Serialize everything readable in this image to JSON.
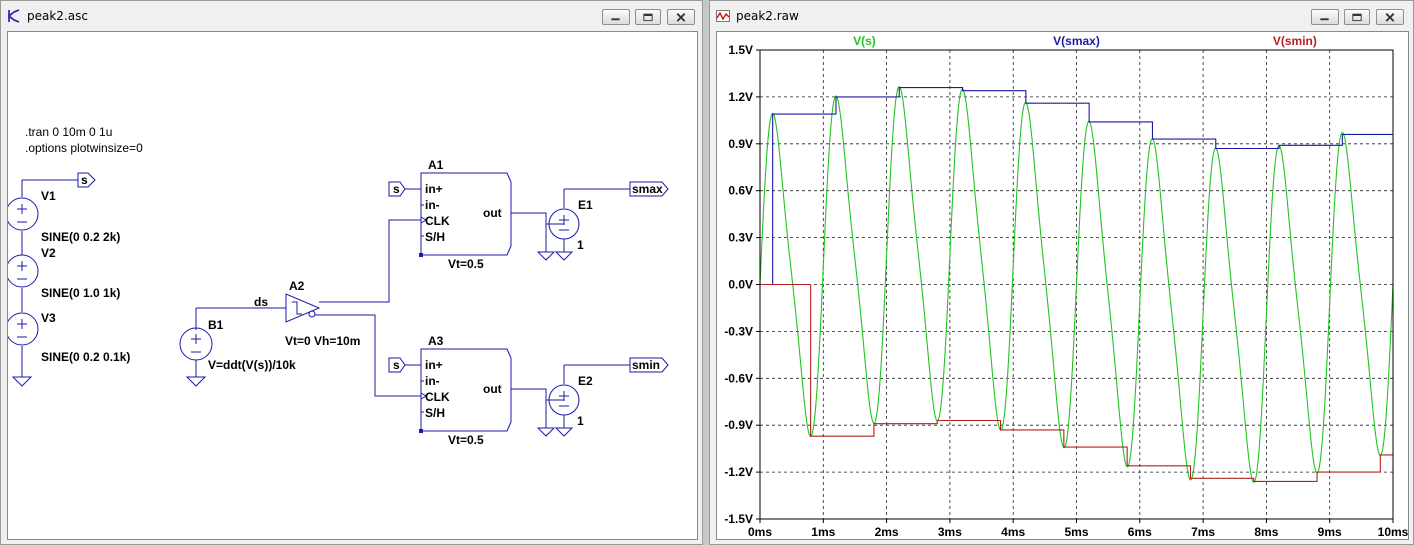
{
  "left_window": {
    "title": "peak2.asc",
    "directives": [
      ".tran 0 10m 0 1u",
      ".options plotwinsize=0"
    ],
    "sources": [
      {
        "ref": "V1",
        "value": "SINE(0 0.2 2k)"
      },
      {
        "ref": "V2",
        "value": "SINE(0 1.0 1k)"
      },
      {
        "ref": "V3",
        "value": "SINE(0 0.2 0.1k)"
      }
    ],
    "b1": {
      "ref": "B1",
      "value": "V=ddt(V(s))/10k"
    },
    "a2": {
      "ref": "A2",
      "params": "Vt=0 Vh=10m",
      "net": "ds"
    },
    "a1": {
      "ref": "A1",
      "pins": [
        "in+",
        "in-",
        "CLK",
        "S/H"
      ],
      "out": "out",
      "params": "Vt=0.5"
    },
    "a3": {
      "ref": "A3",
      "pins": [
        "in+",
        "in-",
        "CLK",
        "S/H"
      ],
      "out": "out",
      "params": "Vt=0.5"
    },
    "e1": {
      "ref": "E1",
      "gain": "1"
    },
    "e2": {
      "ref": "E2",
      "gain": "1"
    },
    "net_labels": {
      "s": "s",
      "smax": "smax",
      "smin": "smin"
    }
  },
  "right_window": {
    "title": "peak2.raw"
  },
  "chart_data": {
    "type": "line",
    "x_unit": "ms",
    "xlim": [
      0,
      10
    ],
    "ylim": [
      -1.5,
      1.5
    ],
    "x_ticks": [
      "0ms",
      "1ms",
      "2ms",
      "3ms",
      "4ms",
      "5ms",
      "6ms",
      "7ms",
      "8ms",
      "9ms",
      "10ms"
    ],
    "y_ticks": [
      "1.5V",
      "1.2V",
      "0.9V",
      "0.6V",
      "0.3V",
      "0.0V",
      "-0.3V",
      "-0.6V",
      "-0.9V",
      "-1.2V",
      "-1.5V"
    ],
    "grid": true,
    "legend_placement": "top",
    "series": [
      {
        "name": "V(s)",
        "color": "#22c422",
        "kind": "formula",
        "formula": "0.2*sin(2*pi*2k*t)+1.0*sin(2*pi*1k*t)+0.2*sin(2*pi*0.1k*t)"
      },
      {
        "name": "V(smax)",
        "color": "#1a1aa8",
        "kind": "step",
        "x": [
          0,
          0.2,
          0.2,
          1.2,
          1.2,
          2.2,
          2.2,
          3.2,
          3.2,
          4.2,
          4.2,
          5.2,
          5.2,
          6.2,
          6.2,
          7.2,
          7.2,
          8.2,
          8.2,
          9.2,
          9.2,
          10
        ],
        "y": [
          0.0,
          0.0,
          1.09,
          1.09,
          1.2,
          1.2,
          1.26,
          1.26,
          1.24,
          1.24,
          1.16,
          1.16,
          1.04,
          1.04,
          0.93,
          0.93,
          0.87,
          0.87,
          0.89,
          0.89,
          0.96,
          0.96
        ]
      },
      {
        "name": "V(smin)",
        "color": "#b42020",
        "kind": "step",
        "x": [
          0,
          0.8,
          0.8,
          1.8,
          1.8,
          2.8,
          2.8,
          3.8,
          3.8,
          4.8,
          4.8,
          5.8,
          5.8,
          6.8,
          6.8,
          7.8,
          7.8,
          8.8,
          8.8,
          9.8,
          9.8,
          10
        ],
        "y": [
          0.0,
          0.0,
          -0.97,
          -0.97,
          -0.89,
          -0.89,
          -0.87,
          -0.87,
          -0.93,
          -0.93,
          -1.04,
          -1.04,
          -1.16,
          -1.16,
          -1.24,
          -1.24,
          -1.26,
          -1.26,
          -1.2,
          -1.2,
          -1.09,
          -1.09
        ]
      }
    ]
  }
}
